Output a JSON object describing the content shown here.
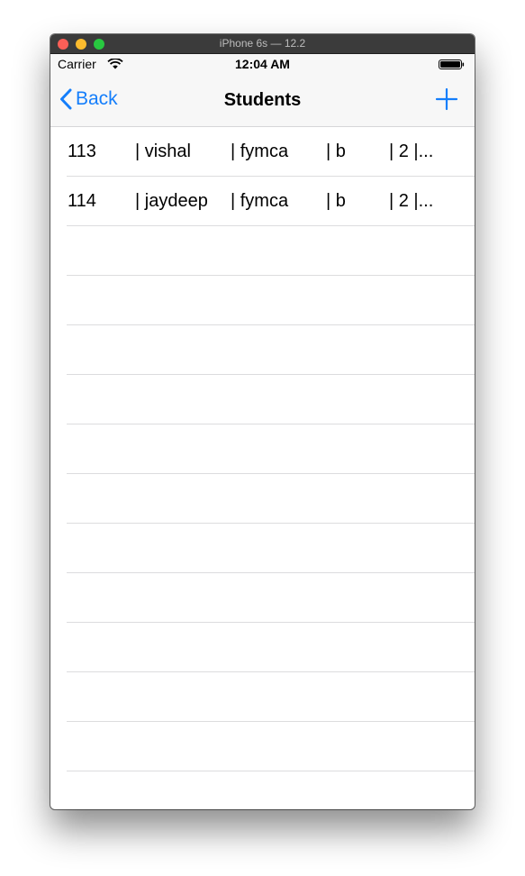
{
  "window": {
    "title": "iPhone 6s — 12.2"
  },
  "status_bar": {
    "carrier": "Carrier",
    "time": "12:04 AM"
  },
  "nav_bar": {
    "back_label": "Back",
    "title": "Students",
    "add_icon": "plus-icon",
    "tint_color": "#147efb"
  },
  "students": [
    {
      "cells": [
        "113",
        "| vishal",
        "| fymca",
        "| b",
        "| 2 |..."
      ]
    },
    {
      "cells": [
        "114",
        "| jaydeep",
        "| fymca",
        "| b",
        "| 2 |..."
      ]
    }
  ],
  "empty_rows": 11
}
